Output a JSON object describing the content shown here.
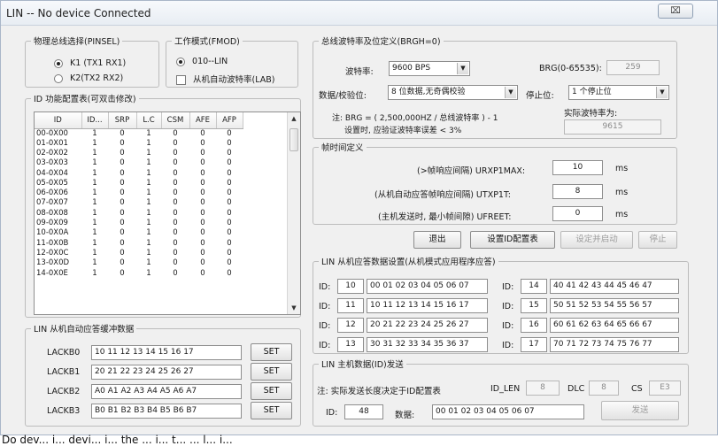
{
  "window": {
    "title": "LIN -- No device Connected",
    "close_glyph": "⌧"
  },
  "physical_bus": {
    "legend": "物理总线选择(PINSEL)",
    "options": [
      {
        "label": "K1 (TX1 RX1)",
        "selected": true
      },
      {
        "label": "K2(TX2 RX2)",
        "selected": false
      }
    ]
  },
  "work_mode": {
    "legend": "工作模式(FMOD)",
    "radio_label": "010--LIN",
    "checkbox_label": "从机自动波特率(LAB)"
  },
  "id_table": {
    "legend": "ID 功能配置表(可双击修改)",
    "headers": [
      "ID",
      "ID...",
      "SRP",
      "L.C",
      "CSM",
      "AFE",
      "AFP"
    ],
    "rows": [
      [
        "00-0X00",
        "1",
        "0",
        "1",
        "0",
        "0",
        "0"
      ],
      [
        "01-0X01",
        "1",
        "0",
        "1",
        "0",
        "0",
        "0"
      ],
      [
        "02-0X02",
        "1",
        "0",
        "1",
        "0",
        "0",
        "0"
      ],
      [
        "03-0X03",
        "1",
        "0",
        "1",
        "0",
        "0",
        "0"
      ],
      [
        "04-0X04",
        "1",
        "0",
        "1",
        "0",
        "0",
        "0"
      ],
      [
        "05-0X05",
        "1",
        "0",
        "1",
        "0",
        "0",
        "0"
      ],
      [
        "06-0X06",
        "1",
        "0",
        "1",
        "0",
        "0",
        "0"
      ],
      [
        "07-0X07",
        "1",
        "0",
        "1",
        "0",
        "0",
        "0"
      ],
      [
        "08-0X08",
        "1",
        "0",
        "1",
        "0",
        "0",
        "0"
      ],
      [
        "09-0X09",
        "1",
        "0",
        "1",
        "0",
        "0",
        "0"
      ],
      [
        "10-0X0A",
        "1",
        "0",
        "1",
        "0",
        "0",
        "0"
      ],
      [
        "11-0X0B",
        "1",
        "0",
        "1",
        "0",
        "0",
        "0"
      ],
      [
        "12-0X0C",
        "1",
        "0",
        "1",
        "0",
        "0",
        "0"
      ],
      [
        "13-0X0D",
        "1",
        "0",
        "1",
        "0",
        "0",
        "0"
      ],
      [
        "14-0X0E",
        "1",
        "0",
        "1",
        "0",
        "0",
        "0"
      ]
    ]
  },
  "auto_response_buffer": {
    "legend": "LIN 从机自动应答缓冲数据",
    "rows": [
      {
        "label": "LACKB0",
        "value": "10 11 12 13 14 15 16 17",
        "button": "SET"
      },
      {
        "label": "LACKB1",
        "value": "20 21 22 23 24 25 26 27",
        "button": "SET"
      },
      {
        "label": "LACKB2",
        "value": "A0 A1 A2 A3 A4 A5 A6 A7",
        "button": "SET"
      },
      {
        "label": "LACKB3",
        "value": "B0 B1 B2 B3 B4 B5 B6 B7",
        "button": "SET"
      }
    ]
  },
  "baud": {
    "legend": "总线波特率及位定义(BRGH=0)",
    "baud_label": "波特率:",
    "baud_value": "9600  BPS",
    "brg_label": "BRG(0-65535):",
    "brg_value": "259",
    "data_parity_label": "数据/校验位:",
    "data_parity_value": "8 位数据,无奇偶校验",
    "stop_label": "停止位:",
    "stop_value": "1 个停止位",
    "note_line1": "注: BRG = ( 2,500,000HZ / 总线波特率 ) - 1",
    "note_line2": "设置时, 应验证波特率误差 < 3%",
    "actual_label": "实际波特率为:",
    "actual_value": "9615"
  },
  "frame_interval": {
    "legend": "帧时间定义",
    "rows": [
      {
        "label": "(>帧响应间隔) URXP1MAX:",
        "value": "10",
        "unit": "ms"
      },
      {
        "label": "(从机自动应答帧响应间隔) UTXP1T:",
        "value": "8",
        "unit": "ms"
      },
      {
        "label": "(主机发送时, 最小帧间隙) UFREET:",
        "value": "0",
        "unit": "ms"
      }
    ]
  },
  "actions": {
    "exit": "退出",
    "set_id_config": "设置ID配置表",
    "set_and_start": "设定并启动",
    "stop": "停止"
  },
  "slave_response": {
    "legend": "LIN 从机应答数据设置(从机模式应用程序应答)",
    "id_label": "ID:",
    "rows": [
      {
        "left_id": "10",
        "left_data": "00 01 02 03 04 05 06 07",
        "right_id": "14",
        "right_data": "40 41 42 43 44 45 46 47"
      },
      {
        "left_id": "11",
        "left_data": "10 11 12 13 14 15 16 17",
        "right_id": "15",
        "right_data": "50 51 52 53 54 55 56 57"
      },
      {
        "left_id": "12",
        "left_data": "20 21 22 23 24 25 26 27",
        "right_id": "16",
        "right_data": "60 61 62 63 64 65 66 67"
      },
      {
        "left_id": "13",
        "left_data": "30 31 32 33 34 35 36 37",
        "right_id": "17",
        "right_data": "70 71 72 73 74 75 76 77"
      }
    ]
  },
  "master_send": {
    "legend": "LIN 主机数据(ID)发送",
    "note": "注: 实际发送长度决定于ID配置表",
    "id_len_label": "ID_LEN",
    "id_len_value": "8",
    "dlc_label": "DLC",
    "dlc_value": "8",
    "cs_label": "CS",
    "cs_value": "E3",
    "id_label": "ID:",
    "id_value": "48",
    "data_label": "数据:",
    "data_value": "00 01 02 03 04 05 06 07",
    "send_button": "发送"
  },
  "footer_text": "Do dev... i... devi... i... the ... i... t... ... l... i..."
}
